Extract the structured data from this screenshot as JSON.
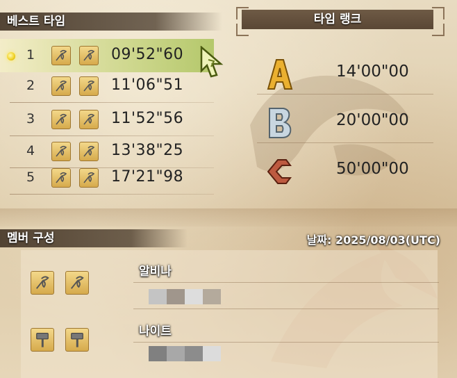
{
  "best_times": {
    "title": "베스트 타임",
    "rows": [
      {
        "rank": "1",
        "time": "09'52\"60",
        "selected": true
      },
      {
        "rank": "2",
        "time": "11'06\"51",
        "selected": false
      },
      {
        "rank": "3",
        "time": "11'52\"56",
        "selected": false
      },
      {
        "rank": "4",
        "time": "13'38\"25",
        "selected": false
      },
      {
        "rank": "5",
        "time": "17'21\"98",
        "selected": false
      }
    ],
    "weapon_icon": "insect-glaive-icon"
  },
  "time_rank": {
    "title": "타임 랭크",
    "ranks": [
      {
        "letter": "A",
        "time": "14'00\"00",
        "color": "#e8a628"
      },
      {
        "letter": "B",
        "time": "20'00\"00",
        "color": "#b8c8d4"
      },
      {
        "letter": "C",
        "time": "50'00\"00",
        "color": "#b8503a"
      }
    ]
  },
  "members": {
    "title": "멤버 구성",
    "date": "날짜: 2025/08/03(UTC)",
    "list": [
      {
        "name": "알비나",
        "weapon_icon": "insect-glaive-icon",
        "censored_colors": [
          "#c4c4c4",
          "#a0968c",
          "#dddddd",
          "#b4aa9c"
        ]
      },
      {
        "name": "나이트",
        "weapon_icon": "hammer-icon",
        "censored_colors": [
          "#808080",
          "#a8a8a8",
          "#8c8c8c",
          "#dcdcdc"
        ]
      }
    ]
  }
}
